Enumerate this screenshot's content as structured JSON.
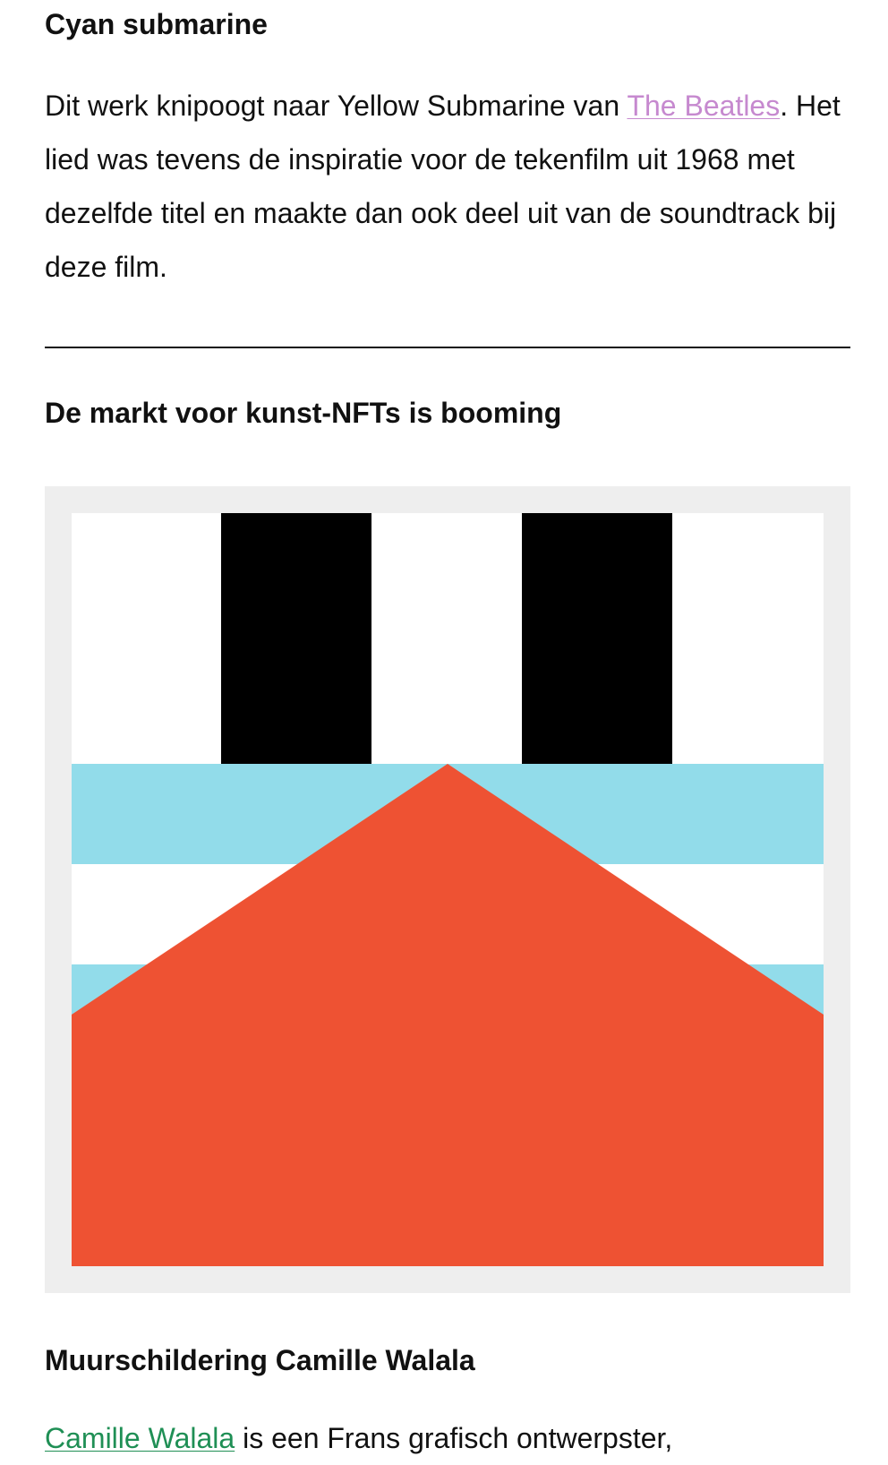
{
  "sections": {
    "cyan_submarine": {
      "title": "Cyan submarine",
      "paragraph_before_link": "Dit werk knipoogt naar Yellow Submarine van ",
      "link_text": "The Beatles",
      "paragraph_after_link": ". Het lied was tevens de inspiratie voor de tekenfilm uit 1968 met dezelfde titel en maakte dan ook deel uit van de soundtrack bij deze film."
    },
    "nft_market": {
      "title": "De markt voor kunst-NFTs is booming"
    },
    "mural": {
      "title": "Muurschildering Camille Walala",
      "link_text": "Camille Walala",
      "paragraph_after_link": " is een Frans grafisch ontwerpster,"
    }
  },
  "colors": {
    "link_purple": "#c689cf",
    "link_green": "#1f8f55",
    "artwork_cyan": "#92dcea",
    "artwork_red": "#ee5233",
    "artwork_black": "#000000",
    "frame_gray": "#eeeeee"
  }
}
